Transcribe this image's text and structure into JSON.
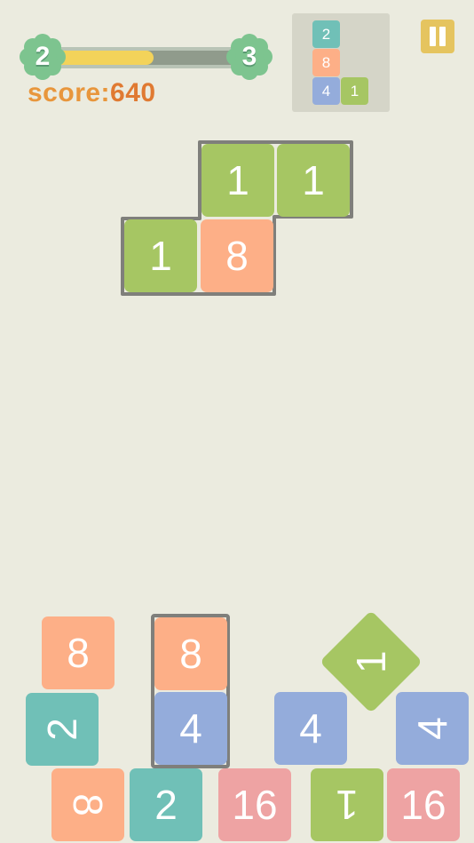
{
  "hud": {
    "level_current": "2",
    "level_next": "3",
    "progress": 0.55,
    "score_label": "score:",
    "score_value": "640"
  },
  "preview": {
    "tiles": [
      "2",
      "8",
      "4",
      "1"
    ]
  },
  "falling_piece": {
    "tiles": [
      "1",
      "1",
      "1",
      "8"
    ]
  },
  "board": {
    "tiles": [
      "8",
      "8",
      "1",
      "2",
      "4",
      "4",
      "4",
      "8",
      "2",
      "16",
      "1",
      "16"
    ]
  },
  "colors": {
    "background": "#ebebdf",
    "green": "#a6c663",
    "orange": "#fdaf87",
    "teal": "#70c0b7",
    "blue": "#94acdb",
    "pink": "#eea3a3",
    "accent_yellow": "#e5c45f",
    "score_orange": "#e8963c"
  },
  "icons": {
    "pause": "pause-icon",
    "level": "flower-badge-icon"
  }
}
